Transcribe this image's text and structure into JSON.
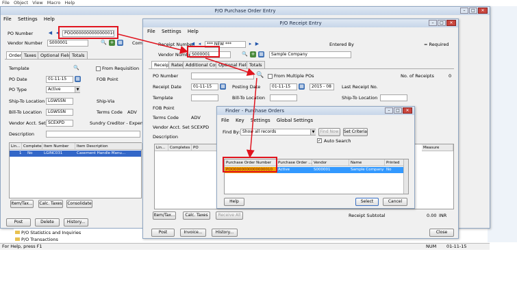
{
  "app_menu": [
    "File",
    "Object",
    "View",
    "Macro",
    "Help"
  ],
  "po_entry": {
    "title": "P/O Purchase Order Entry",
    "menu": [
      "File",
      "Settings",
      "Help"
    ],
    "po_number_label": "PO Number",
    "po_number_value": "POO0000000000000010",
    "vendor_number_label": "Vendor Number",
    "vendor_number_value": "S000001",
    "tabs": [
      "Order",
      "Taxes",
      "Optional Fields",
      "Totals"
    ],
    "template_label": "Template",
    "po_date_label": "PO Date",
    "po_date_value": "01-11-15",
    "po_type_label": "PO Type",
    "po_type_value": "Active",
    "ship_to_label": "Ship-To Location",
    "ship_to_value": "LGWSSN",
    "bill_to_label": "Bill-To Location",
    "bill_to_value": "LGWSSN",
    "vendor_acct_label": "Vendor Acct. Set",
    "vendor_acct_value": "SCEXPD",
    "description_label": "Description",
    "from_requisition": "From Requisition",
    "fob_point": "FOB Point",
    "ship_via": "Ship-Via",
    "terms_code_label": "Terms Code",
    "terms_code_value": "ADV",
    "sundry": "Sundry Creditor - Expenses",
    "grid_headers": [
      "Lin...",
      "Completed",
      "Item Number",
      "Item Description"
    ],
    "grid_row": [
      "1",
      "No",
      "LGINC031",
      "Casement Handle Manu..."
    ],
    "buttons_row1": [
      "Item/Tax...",
      "Calc. Taxes",
      "Consolidate"
    ],
    "buttons_row2": [
      "Post",
      "Delete",
      "History..."
    ]
  },
  "receipt_entry": {
    "title": "P/O Receipt Entry",
    "menu": [
      "File",
      "Settings",
      "Help"
    ],
    "receipt_number_label": "Receipt Number",
    "receipt_number_value": "*** NEW ***",
    "entered_by": "Entered By",
    "required": "= Required",
    "vendor_number_label": "Vendor Number",
    "vendor_number_value": "S000001",
    "vendor_name": "Sample Company",
    "tabs": [
      "Receipt",
      "Rates",
      "Additional Costs",
      "Optional Fields",
      "Totals"
    ],
    "po_number_label": "PO Number",
    "from_multiple": "From Multiple POs",
    "no_receipts_label": "No. of Receipts",
    "no_receipts_value": "0",
    "receipt_date_label": "Receipt Date",
    "receipt_date_value": "01-11-15",
    "posting_date_label": "Posting Date",
    "posting_date_value": "01-11-15",
    "period_value": "2015 - 08",
    "last_receipt": "Last Receipt No.",
    "template_label": "Template",
    "bill_to_label": "Bill-To Location",
    "ship_to_label": "Ship-To Location",
    "fob_label": "FOB Point",
    "terms_label": "Terms Code",
    "terms_value": "ADV",
    "vendor_acct_label": "Vendor Acct. Set",
    "vendor_acct_value": "SCEXPD",
    "description_label": "Description",
    "grid_headers": [
      "Lin...",
      "Completes",
      "PO"
    ],
    "uom_header": "Measure",
    "buttons_row1": [
      "Item/Tax...",
      "Calc. Taxes",
      "Receive All"
    ],
    "receipt_subtotal": "Receipt Subtotal",
    "subtotal_value": "0.00",
    "currency": "INR",
    "buttons_row2": [
      "Post",
      "Invoice...",
      "History..."
    ],
    "close_button": "Close"
  },
  "finder": {
    "title": "Finder - Purchase Orders",
    "menu": [
      "File",
      "Key",
      "Settings",
      "Global Settings"
    ],
    "find_by_label": "Find By:",
    "find_by_value": "Show all records",
    "find_now": "Find Now",
    "set_criteria": "Set Criteria",
    "auto_search": "Auto Search",
    "columns": [
      "Purchase Order Number",
      "Purchase Order ...",
      "Vendor",
      "Name",
      "Printed"
    ],
    "row": [
      "POO0000000000000010",
      "Active",
      "S000001",
      "Sample Company",
      "No"
    ],
    "help": "Help",
    "select": "Select",
    "cancel": "Cancel"
  },
  "left_tree": [
    "P/O Statistics and Inquiries",
    "P/O Transactions"
  ],
  "status_bar": {
    "help_text": "For Help, press F1",
    "num": "NUM",
    "date": "01-11-15"
  },
  "colors": {
    "annotation_red": "#e0141e",
    "selection_blue": "#3399ff",
    "titlebar": "#c7d6e9"
  }
}
